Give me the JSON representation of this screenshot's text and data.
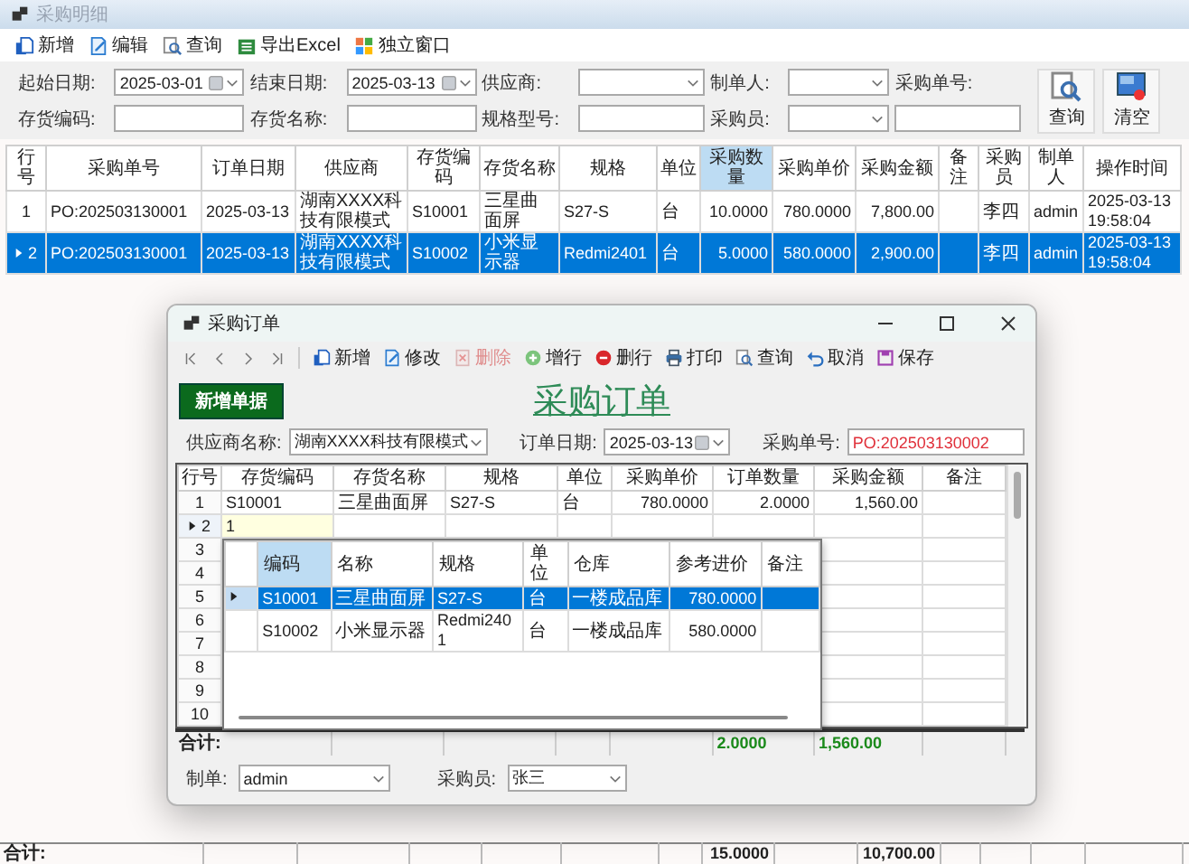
{
  "main_window": {
    "title": "采购明细",
    "toolbar": [
      {
        "label": "新增",
        "kind": "new"
      },
      {
        "label": "编辑",
        "kind": "edit"
      },
      {
        "label": "查询",
        "kind": "query"
      },
      {
        "label": "导出Excel",
        "kind": "export"
      },
      {
        "label": "独立窗口",
        "kind": "window"
      }
    ],
    "filters": [
      {
        "label": "起始日期:",
        "kind": "date",
        "value": "2025-03-01"
      },
      {
        "label": "结束日期:",
        "kind": "date",
        "value": "2025-03-13"
      },
      {
        "label": "供应商:",
        "kind": "combo"
      },
      {
        "label": "制单人:",
        "kind": "combo"
      },
      {
        "label": "采购单号:",
        "kind": "stacked-text"
      },
      {
        "label": "存货编码:",
        "kind": "text"
      },
      {
        "label": "存货名称:",
        "kind": "text"
      },
      {
        "label": "规格型号:",
        "kind": "text"
      },
      {
        "label": "采购员:",
        "kind": "combo"
      }
    ],
    "action_buttons": [
      {
        "label": "查询",
        "kind": "query"
      },
      {
        "label": "清空",
        "kind": "clear"
      }
    ],
    "table": {
      "columns": [
        {
          "label": "行号",
          "kind": "index",
          "highlighted": false
        },
        {
          "label": "采购单号",
          "kind": "code",
          "highlighted": false
        },
        {
          "label": "订单日期",
          "kind": "code",
          "highlighted": false
        },
        {
          "label": "供应商",
          "kind": "text",
          "highlighted": false
        },
        {
          "label": "存货编码",
          "kind": "code",
          "highlighted": false
        },
        {
          "label": "存货名称",
          "kind": "text",
          "highlighted": false
        },
        {
          "label": "规格",
          "kind": "code",
          "highlighted": false
        },
        {
          "label": "单位",
          "kind": "text",
          "highlighted": false
        },
        {
          "label": "采购数量",
          "kind": "number",
          "highlighted": true
        },
        {
          "label": "采购单价",
          "kind": "number",
          "highlighted": false
        },
        {
          "label": "采购金额",
          "kind": "number",
          "highlighted": false
        },
        {
          "label": "备注",
          "kind": "text",
          "highlighted": false
        },
        {
          "label": "采购员",
          "kind": "text",
          "highlighted": false
        },
        {
          "label": "制单人",
          "kind": "code",
          "highlighted": false
        },
        {
          "label": "操作时间",
          "kind": "code",
          "highlighted": false
        }
      ],
      "rows": [
        {
          "selected": false,
          "no": "1",
          "order_no": "PO:202503130001",
          "date": "2025-03-13",
          "supplier": "湖南XXXX科技有限模式",
          "item_code": "S10001",
          "item_name": "三星曲面屏",
          "spec": "S27-S",
          "unit": "台",
          "quantity": "10.0000",
          "unit_price": "780.0000",
          "amount": "7,800.00",
          "buyer": "李四",
          "creator": "admin",
          "time": "2025-03-13 19:58:04"
        },
        {
          "selected": true,
          "no": "2",
          "order_no": "PO:202503130001",
          "date": "2025-03-13",
          "supplier": "湖南XXXX科技有限模式",
          "item_code": "S10002",
          "item_name": "小米显示器",
          "spec": "Redmi2401",
          "unit": "台",
          "quantity": "5.0000",
          "unit_price": "580.0000",
          "amount": "2,900.00",
          "buyer": "李四",
          "creator": "admin",
          "time": "2025-03-13 19:58:04"
        }
      ]
    },
    "totals": {
      "label": "合计:",
      "quantity": "15.0000",
      "amount": "10,700.00"
    }
  },
  "order_dialog": {
    "title": "采购订单",
    "nav": [
      {
        "kind": "first"
      },
      {
        "kind": "previous"
      },
      {
        "kind": "next"
      },
      {
        "kind": "last"
      }
    ],
    "toolbar": [
      {
        "label": "新增",
        "kind": "new",
        "disabled": false
      },
      {
        "label": "修改",
        "kind": "edit",
        "disabled": false
      },
      {
        "label": "删除",
        "kind": "delete",
        "disabled": true
      },
      {
        "label": "增行",
        "kind": "add-row",
        "disabled": false
      },
      {
        "label": "删行",
        "kind": "delete-row",
        "disabled": false
      },
      {
        "label": "打印",
        "kind": "print",
        "disabled": false
      },
      {
        "label": "查询",
        "kind": "query",
        "disabled": false
      },
      {
        "label": "取消",
        "kind": "cancel",
        "disabled": false
      },
      {
        "label": "保存",
        "kind": "save",
        "disabled": false
      }
    ],
    "new_button": "新增单据",
    "heading": "采购订单",
    "fields": [
      {
        "label": "供应商名称:",
        "kind": "combo",
        "value": "湖南XXXX科技有限模式"
      },
      {
        "label": "订单日期:",
        "kind": "date",
        "value": "2025-03-13"
      },
      {
        "label": "采购单号:",
        "kind": "serial",
        "value": "PO:202503130002"
      }
    ],
    "grid": {
      "columns": [
        {
          "label": "行号",
          "kind": "index"
        },
        {
          "label": "存货编码",
          "kind": "code"
        },
        {
          "label": "存货名称",
          "kind": "text"
        },
        {
          "label": "规格",
          "kind": "code"
        },
        {
          "label": "单位",
          "kind": "text"
        },
        {
          "label": "采购单价",
          "kind": "number"
        },
        {
          "label": "订单数量",
          "kind": "number"
        },
        {
          "label": "采购金额",
          "kind": "number"
        },
        {
          "label": "备注",
          "kind": "text"
        }
      ],
      "rows": [
        {
          "no": "1",
          "current": false,
          "editing": false,
          "item_code": "S10001",
          "item_name": "三星曲面屏",
          "spec": "S27-S",
          "unit": "台",
          "unit_price": "780.0000",
          "quantity": "2.0000",
          "amount": "1,560.00"
        },
        {
          "no": "2",
          "current": true,
          "editing": true,
          "item_code": "1"
        },
        {
          "no": "3",
          "current": false
        },
        {
          "no": "4",
          "current": false
        },
        {
          "no": "5",
          "current": false
        },
        {
          "no": "6",
          "current": false
        },
        {
          "no": "7",
          "current": false
        },
        {
          "no": "8",
          "current": false
        },
        {
          "no": "9",
          "current": false
        },
        {
          "no": "10",
          "current": false
        }
      ]
    },
    "lookup": {
      "columns": [
        {
          "label": "编码",
          "kind": "code",
          "highlighted": true
        },
        {
          "label": "名称",
          "kind": "text",
          "highlighted": false
        },
        {
          "label": "规格",
          "kind": "code",
          "highlighted": false
        },
        {
          "label": "单位",
          "kind": "text",
          "highlighted": false
        },
        {
          "label": "仓库",
          "kind": "text",
          "highlighted": false
        },
        {
          "label": "参考进价",
          "kind": "number",
          "highlighted": false
        },
        {
          "label": "备注",
          "kind": "text",
          "highlighted": false
        }
      ],
      "rows": [
        {
          "selected": true,
          "code": "S10001",
          "name": "三星曲面屏",
          "spec": "S27-S",
          "unit": "台",
          "warehouse": "一楼成品库",
          "ref_price": "780.0000"
        },
        {
          "selected": false,
          "code": "S10002",
          "name": "小米显示器",
          "spec": "Redmi2401",
          "unit": "台",
          "warehouse": "一楼成品库",
          "ref_price": "580.0000"
        }
      ]
    },
    "totals": {
      "label": "合计:",
      "quantity": "2.0000",
      "amount": "1,560.00"
    },
    "footer_fields": [
      {
        "label": "制单:",
        "kind": "combo",
        "value": "admin"
      },
      {
        "label": "采购员:",
        "kind": "combo",
        "value": "张三"
      }
    ]
  }
}
